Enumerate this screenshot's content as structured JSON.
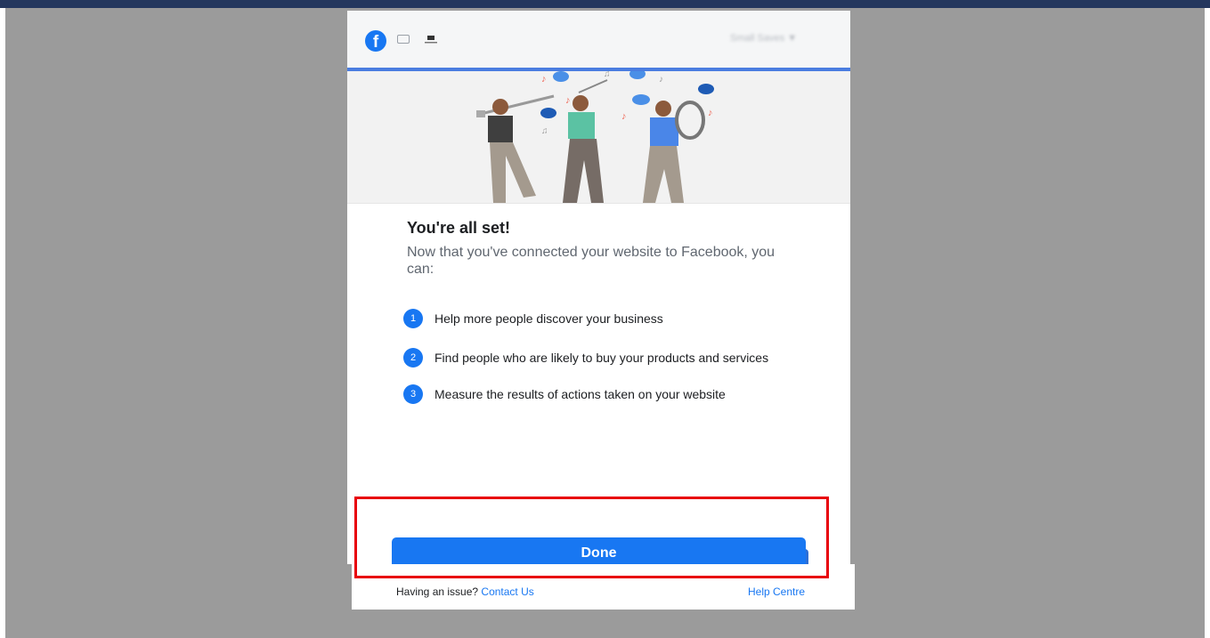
{
  "header": {
    "logo_letter": "f",
    "account_label": "Small Saves ▼"
  },
  "content": {
    "title": "You're all set!",
    "subtitle": "Now that you've connected your website to Facebook, you can:",
    "steps": [
      {
        "number": "1",
        "text": "Help more people discover your business"
      },
      {
        "number": "2",
        "text": "Find people who are likely to buy your products and services"
      },
      {
        "number": "3",
        "text": "Measure the results of actions taken on your website"
      }
    ]
  },
  "actions": {
    "done_label": "Done"
  },
  "footer": {
    "issue_text": "Having an issue?",
    "contact_label": "Contact Us",
    "help_label": "Help Centre"
  },
  "colors": {
    "brand_blue": "#1877f2",
    "top_bar": "#24375e",
    "page_overlay": "#9b9b9b",
    "highlight_border": "#e8000b"
  },
  "icons": [
    "facebook-logo-icon",
    "chat-bubble-icon",
    "shop-icon",
    "musicians-illustration"
  ]
}
